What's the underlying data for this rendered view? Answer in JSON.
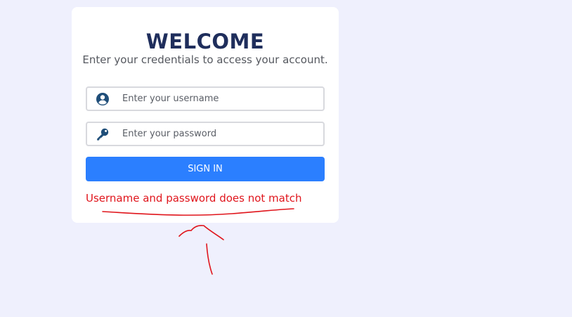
{
  "login": {
    "title": "WELCOME",
    "subtitle": "Enter your credentials to access your account.",
    "username": {
      "placeholder": "Enter your username",
      "value": "",
      "icon": "user-circle-icon"
    },
    "password": {
      "placeholder": "Enter your password",
      "value": "",
      "icon": "key-icon"
    },
    "signin_label": "SIGN IN",
    "error_message": "Username and password does not match"
  },
  "colors": {
    "background": "#eff0fd",
    "card": "#ffffff",
    "title": "#1f2e5c",
    "primary_button": "#2b7fff",
    "error": "#e0151c",
    "icon": "#1f4e79",
    "annotation": "#e0151c"
  }
}
